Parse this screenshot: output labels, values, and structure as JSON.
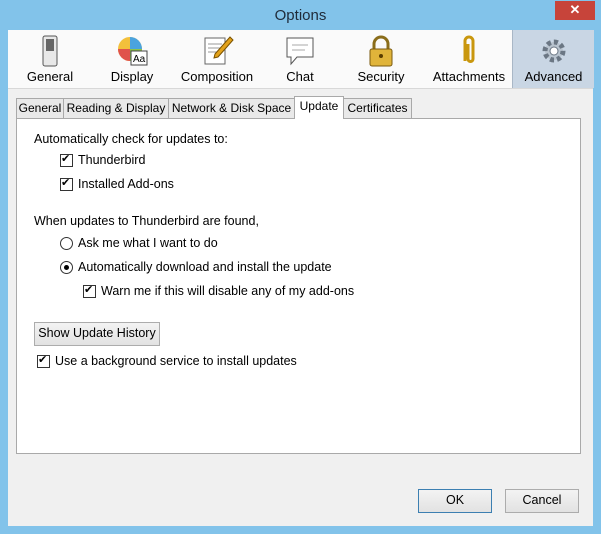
{
  "window": {
    "title": "Options",
    "close_glyph": "✕"
  },
  "toolbar": {
    "panes": [
      {
        "label": "General",
        "icon": "switch-icon"
      },
      {
        "label": "Display",
        "icon": "color-wheel-icon"
      },
      {
        "label": "Composition",
        "icon": "compose-pencil-icon"
      },
      {
        "label": "Chat",
        "icon": "chat-bubble-icon"
      },
      {
        "label": "Security",
        "icon": "padlock-icon"
      },
      {
        "label": "Attachments",
        "icon": "paperclip-icon"
      },
      {
        "label": "Advanced",
        "icon": "gear-icon"
      }
    ],
    "active": "Advanced"
  },
  "tabs": {
    "items": [
      "General",
      "Reading & Display",
      "Network & Disk Space",
      "Update",
      "Certificates"
    ],
    "active": "Update"
  },
  "update": {
    "auto_check_heading": "Automatically check for updates to:",
    "thunderbird_label": "Thunderbird",
    "thunderbird_checked": true,
    "addons_label": "Installed Add-ons",
    "addons_checked": true,
    "when_found_heading": "When updates to Thunderbird are found,",
    "ask_label": "Ask me what I want to do",
    "ask_selected": false,
    "auto_download_label": "Automatically download and install the update",
    "auto_download_selected": true,
    "warn_label": "Warn me if this will disable any of my add-ons",
    "warn_checked": true,
    "history_button": "Show Update History",
    "background_service_label": "Use a background service to install updates",
    "background_service_checked": true
  },
  "footer": {
    "ok_label": "OK",
    "cancel_label": "Cancel"
  },
  "colors": {
    "titlebar": "#82c3ea",
    "close": "#c7443a",
    "active_pane": "#c9d6e4"
  }
}
